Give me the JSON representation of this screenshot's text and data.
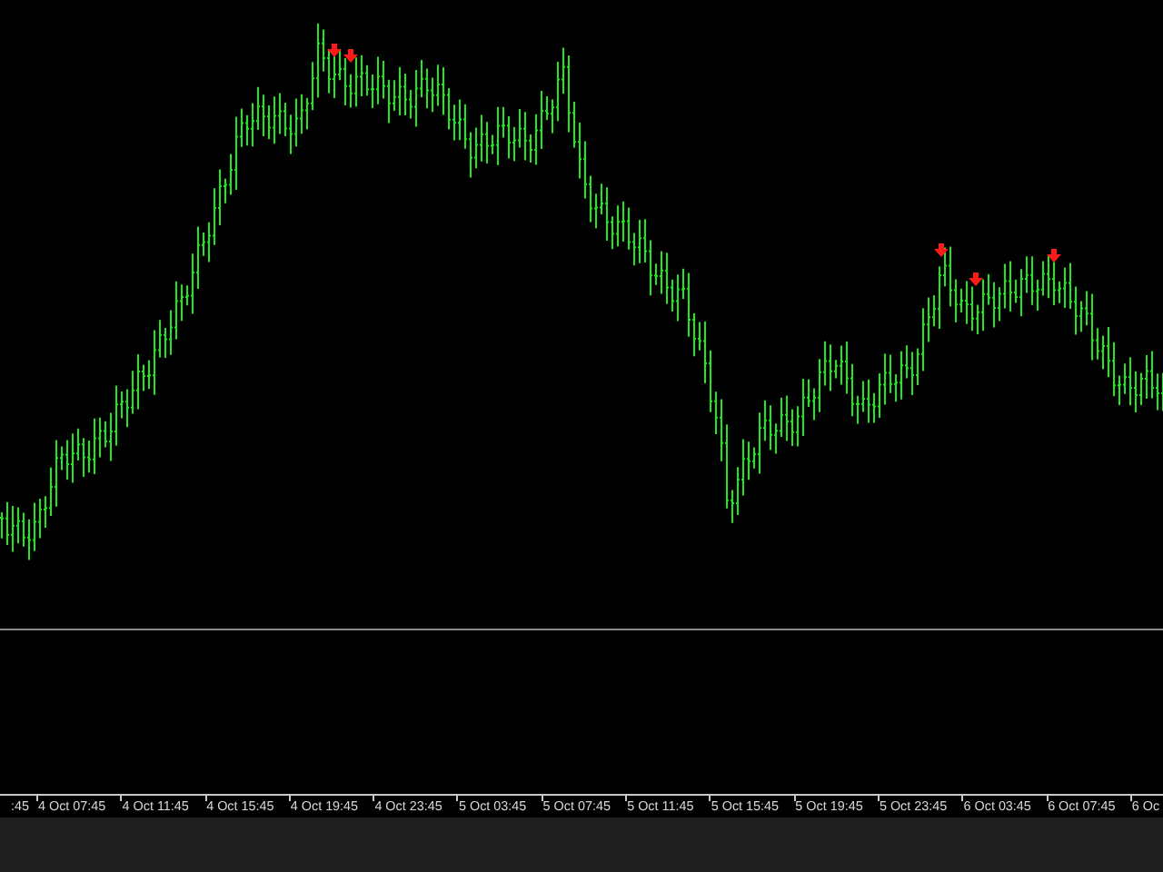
{
  "time_axis": {
    "labels": [
      ":45",
      "4 Oct 07:45",
      "4 Oct 11:45",
      "4 Oct 15:45",
      "4 Oct 19:45",
      "4 Oct 23:45",
      "5 Oct 03:45",
      "5 Oct 07:45",
      "5 Oct 11:45",
      "5 Oct 15:45",
      "5 Oct 19:45",
      "5 Oct 23:45",
      "6 Oct 03:45",
      "6 Oct 07:45",
      "6 Oc"
    ]
  }
}
